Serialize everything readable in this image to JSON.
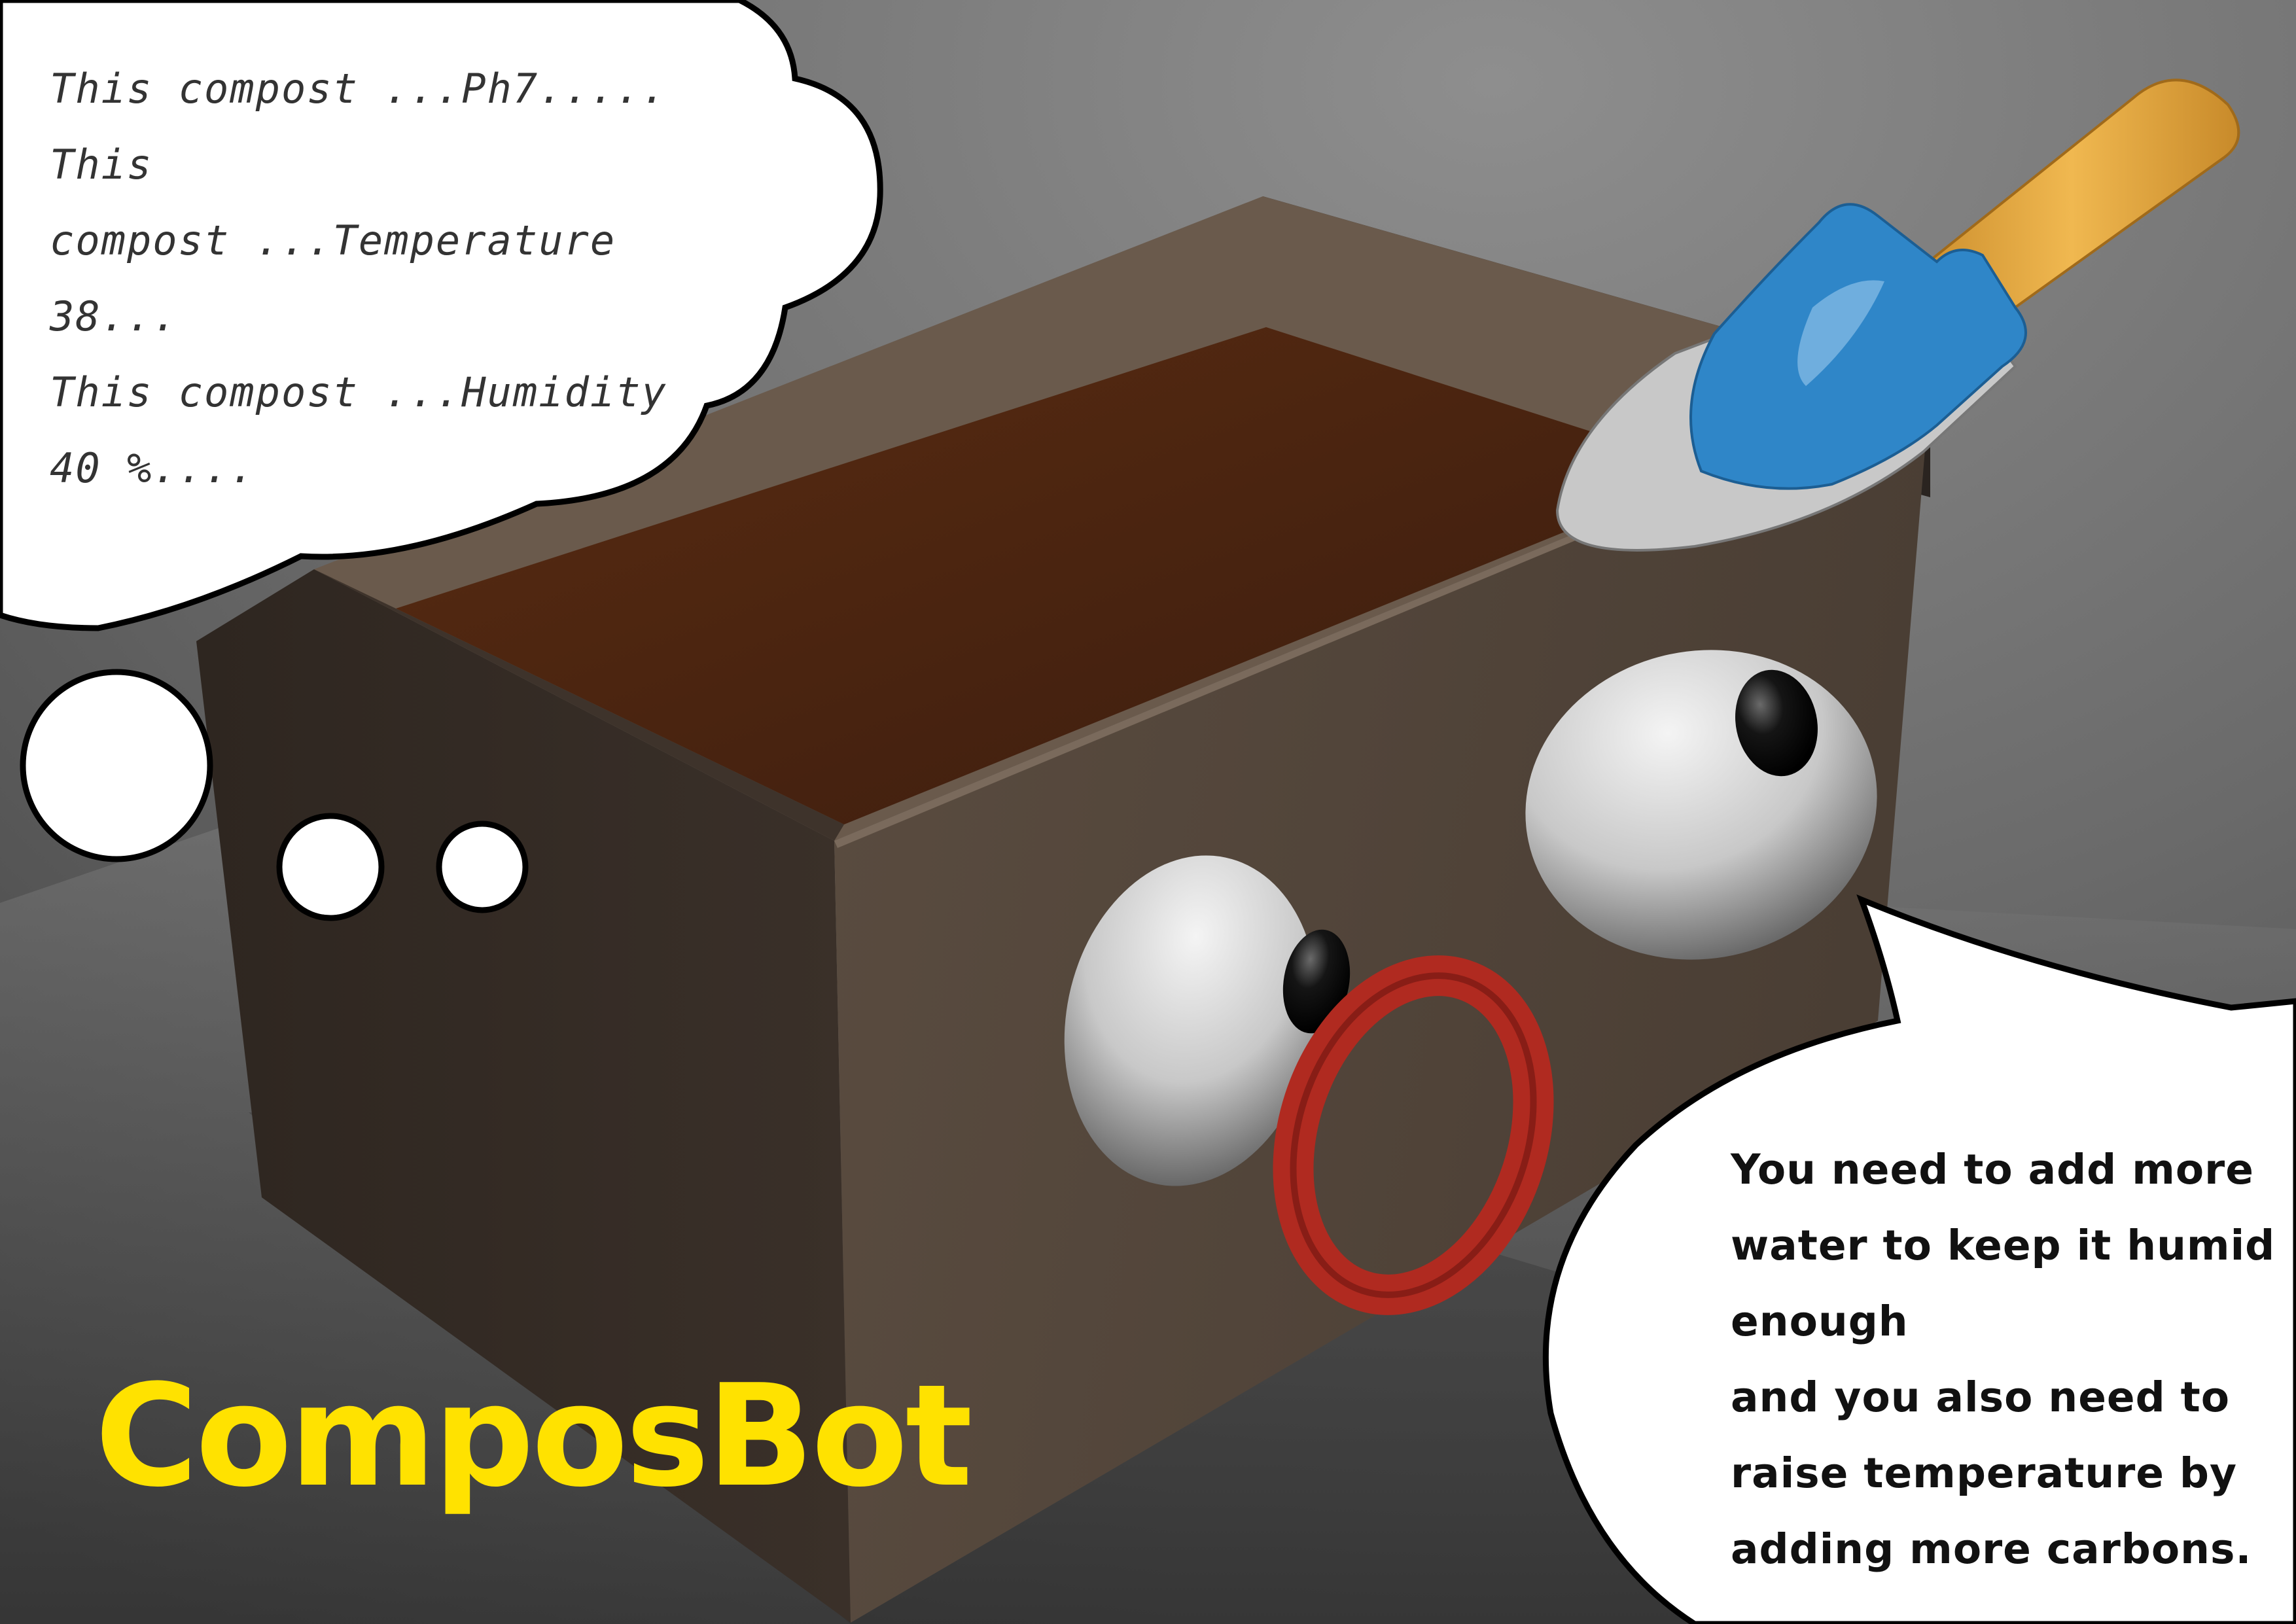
{
  "title": {
    "text": "ComposBot",
    "color": "#ffe200"
  },
  "thought_bubble": {
    "lines": [
      "This compost ...Ph7.....",
      "This",
      "compost ...Temperature",
      "38...",
      "This compost ...Humidity",
      "40 %...."
    ]
  },
  "speech_bubble": {
    "lines": [
      "You need to add more",
      "water to keep it humid",
      "enough",
      "and you also need to",
      "raise temperature by",
      "adding more carbons."
    ]
  },
  "colors": {
    "box": "#5a4d42",
    "soil": "#4a2412",
    "mouth": "#b02a20",
    "trowel_blade": "#2f86c8",
    "trowel_handle": "#e0a640",
    "bubble_fill": "#ffffff",
    "bubble_stroke": "#000000"
  },
  "icons": [
    "compost-box",
    "eye-icon",
    "mouth-ring",
    "trowel-icon"
  ]
}
